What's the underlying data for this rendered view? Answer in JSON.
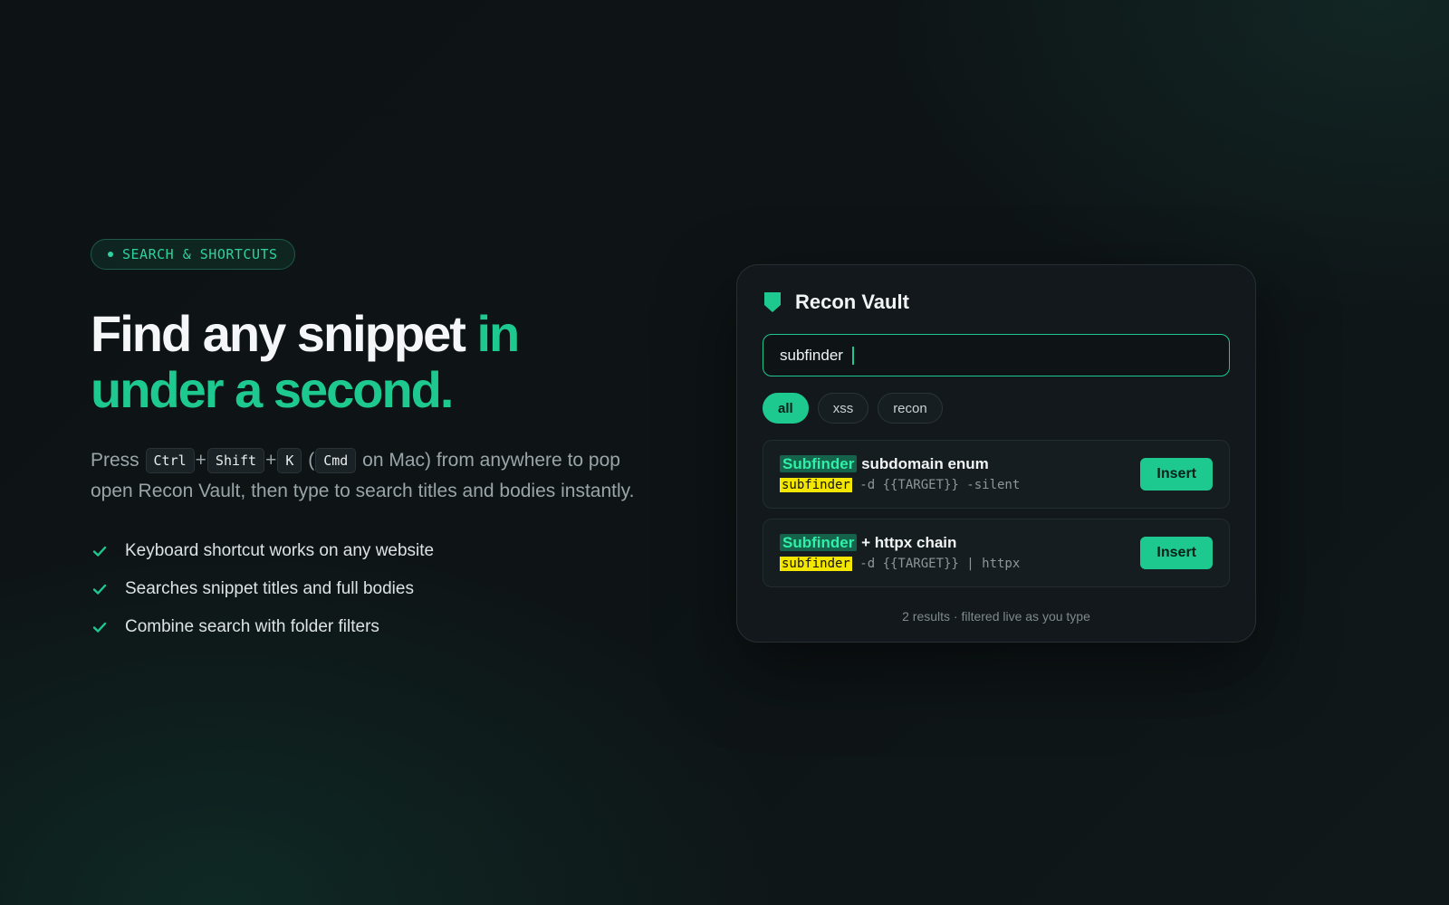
{
  "hero": {
    "badge": "SEARCH & SHORTCUTS",
    "headline_plain": "Find any snippet ",
    "headline_accent": "in under a second.",
    "desc": {
      "press": "Press",
      "keys": [
        "Ctrl",
        "Shift",
        "K"
      ],
      "plus": "+",
      "paren_open": "(",
      "mac_key": "Cmd",
      "rest": " on Mac) from anywhere to pop open Recon Vault, then type to search titles and bodies instantly."
    },
    "features": [
      "Keyboard shortcut works on any website",
      "Searches snippet titles and full bodies",
      "Combine search with folder filters"
    ]
  },
  "vault": {
    "title": "Recon Vault",
    "search_value": "subfinder",
    "chips": [
      "all",
      "xss",
      "recon"
    ],
    "active_chip": "all",
    "results": [
      {
        "title_match": "Subfinder",
        "title_rest": " subdomain enum",
        "body_match": "subfinder",
        "body_rest": " -d {{TARGET}} -silent",
        "action": "Insert"
      },
      {
        "title_match": "Subfinder",
        "title_rest": " + httpx chain",
        "body_match": "subfinder",
        "body_rest": " -d {{TARGET}} | httpx",
        "action": "Insert"
      }
    ],
    "footer": "2 results · filtered live as you type"
  },
  "colors": {
    "accent": "#1ec98f",
    "highlight": "#f3e600",
    "background": "#0e1416"
  },
  "icons": [
    "shield-icon",
    "check-icon"
  ]
}
